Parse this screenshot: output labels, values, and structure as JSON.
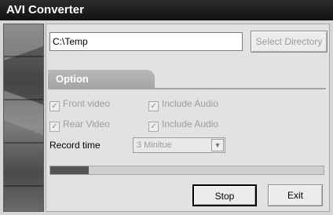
{
  "window": {
    "title": "AVI Converter"
  },
  "directory": {
    "value": "C:\\Temp",
    "select_label": "Select Directory"
  },
  "options": {
    "tab_label": "Option",
    "front_video": {
      "label": "Front video",
      "checked": true
    },
    "rear_video": {
      "label": "Rear Video",
      "checked": true
    },
    "include_audio_1": {
      "label": "Include Audio",
      "checked": true
    },
    "include_audio_2": {
      "label": "Include Audio",
      "checked": true
    }
  },
  "record": {
    "label": "Record time",
    "value": "3 Minitue"
  },
  "progress": {
    "fraction": 0.14
  },
  "buttons": {
    "stop": "Stop",
    "exit": "Exit"
  },
  "colors": {
    "title_bg": "#1a1a1a",
    "progress_fill": "#555555"
  }
}
